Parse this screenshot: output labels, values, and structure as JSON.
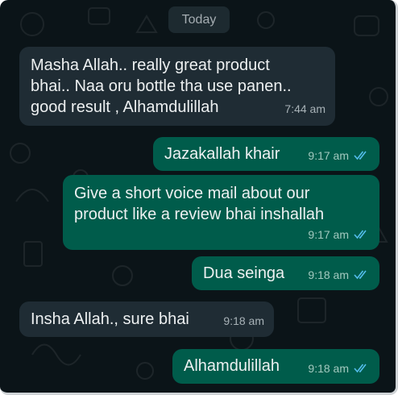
{
  "date_chip": "Today",
  "messages": [
    {
      "direction": "in",
      "lines": [
        "Masha Allah.. really great product",
        "bhai..  Naa oru bottle tha use panen..",
        "good result , Alhamdulillah"
      ],
      "time": "7:44 am"
    },
    {
      "direction": "out",
      "lines": [
        "Jazakallah khair"
      ],
      "time": "9:17 am",
      "status": "read"
    },
    {
      "direction": "out",
      "lines": [
        "Give a short voice mail about our",
        "product like a review bhai inshallah"
      ],
      "time": "9:17 am",
      "status": "read"
    },
    {
      "direction": "out",
      "lines": [
        "Dua seinga"
      ],
      "time": "9:18 am",
      "status": "read"
    },
    {
      "direction": "in",
      "lines": [
        "Insha Allah., sure bhai"
      ],
      "time": "9:18 am"
    },
    {
      "direction": "out",
      "lines": [
        "Alhamdulillah"
      ],
      "time": "9:18 am",
      "status": "read"
    }
  ],
  "colors": {
    "background": "#0b1418",
    "incoming_bubble": "#1f2c34",
    "outgoing_bubble": "#005c4b",
    "read_ticks": "#53bdeb"
  },
  "icons": {
    "read_status": "double-check-icon"
  }
}
